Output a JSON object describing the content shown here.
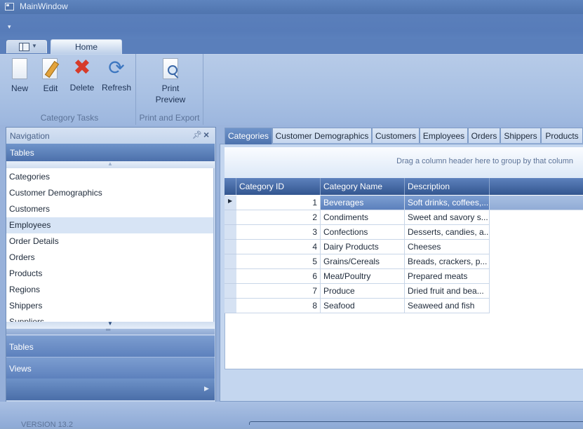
{
  "window": {
    "title": "MainWindow"
  },
  "ribbon": {
    "home_tab": "Home",
    "groups": [
      {
        "label": "Category Tasks",
        "buttons": [
          "New",
          "Edit",
          "Delete",
          "Refresh"
        ]
      },
      {
        "label": "Print and Export",
        "buttons": [
          "Print\nPreview"
        ]
      }
    ],
    "print_preview_line1": "Print",
    "print_preview_line2": "Preview"
  },
  "navigation": {
    "header": "Navigation",
    "section_title": "Tables",
    "items": [
      "Categories",
      "Customer Demographics",
      "Customers",
      "Employees",
      "Order Details",
      "Orders",
      "Products",
      "Regions",
      "Shippers",
      "Suppliers"
    ],
    "selected_item": "Employees",
    "bottom_buttons": [
      "Tables",
      "Views"
    ]
  },
  "doc_tabs": [
    "Categories",
    "Customer Demographics",
    "Customers",
    "Employees",
    "Orders",
    "Shippers",
    "Products"
  ],
  "active_doc_tab": "Categories",
  "grid": {
    "group_hint": "Drag a column header here to group by that column",
    "columns": [
      "Category ID",
      "Category Name",
      "Description"
    ],
    "rows": [
      {
        "id": "1",
        "name": "Beverages",
        "desc": "Soft drinks, coffees,..."
      },
      {
        "id": "2",
        "name": "Condiments",
        "desc": "Sweet and savory s..."
      },
      {
        "id": "3",
        "name": "Confections",
        "desc": "Desserts, candies, a..."
      },
      {
        "id": "4",
        "name": "Dairy Products",
        "desc": "Cheeses"
      },
      {
        "id": "5",
        "name": "Grains/Cereals",
        "desc": "Breads, crackers, p..."
      },
      {
        "id": "6",
        "name": "Meat/Poultry",
        "desc": "Prepared meats"
      },
      {
        "id": "7",
        "name": "Produce",
        "desc": "Dried fruit and bea..."
      },
      {
        "id": "8",
        "name": "Seafood",
        "desc": "Seaweed and fish"
      }
    ],
    "selected_row": 0
  },
  "status": {
    "version": "VERSION 13.2"
  },
  "icons": [
    "app-icon",
    "qat-dropdown-icon",
    "app-menu-icon",
    "new-icon",
    "edit-icon",
    "delete-icon",
    "refresh-icon",
    "print-preview-icon",
    "pin-icon",
    "close-icon",
    "scroll-up-icon",
    "scroll-down-icon",
    "expand-arrow-icon",
    "row-indicator-icon"
  ]
}
